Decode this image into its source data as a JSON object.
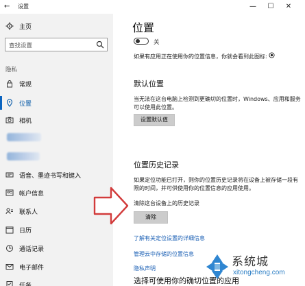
{
  "window": {
    "title": "设置",
    "back_icon": "back-arrow-icon",
    "minimize_glyph": "—",
    "maximize_glyph": "☐",
    "close_glyph": "✕"
  },
  "sidebar": {
    "home_label": "主页",
    "search_placeholder": "查找设置",
    "group_label": "隐私",
    "items": [
      {
        "label": "常规",
        "icon": "lock-icon",
        "active": false
      },
      {
        "label": "位置",
        "icon": "location-icon",
        "active": true
      },
      {
        "label": "相机",
        "icon": "camera-icon",
        "active": false
      },
      {
        "label": "语音、墨迹书写和键入",
        "icon": "ink-icon",
        "active": false
      },
      {
        "label": "帐户信息",
        "icon": "account-icon",
        "active": false
      },
      {
        "label": "联系人",
        "icon": "contacts-icon",
        "active": false
      },
      {
        "label": "日历",
        "icon": "calendar-icon",
        "active": false
      },
      {
        "label": "通话记录",
        "icon": "call-history-icon",
        "active": false
      },
      {
        "label": "电子邮件",
        "icon": "email-icon",
        "active": false
      },
      {
        "label": "任务",
        "icon": "tasks-icon",
        "active": false
      }
    ],
    "accent_color": "#0a64c0"
  },
  "main": {
    "page_title": "位置",
    "toggle_state_label": "关",
    "app_using_text": "如果有应用正在使用你的位置信息，你就会看到此图标:",
    "app_using_icon": "location-indicator-icon",
    "default_location": {
      "title": "默认位置",
      "description": "当无法在这台电脑上检测到更确切的位置时，Windows、应用和服务可以使用此位置。",
      "button_label": "设置默认值"
    },
    "history": {
      "title": "位置历史记录",
      "description": "如果定位功能已打开，则你的位置历史记录将在设备上被存储一段有限的时间，并可供使用你的位置信息的应用使用。",
      "clear_label": "清除这台设备上的历史记录",
      "clear_button": "清除"
    },
    "links": [
      "了解有关定位设置的详细信息",
      "管理云中存储的位置信息",
      "隐私声明"
    ],
    "bottom_title": "选择可使用你的确切位置的应用"
  },
  "watermark": {
    "brand": "系统城",
    "url": "xitongcheng.com"
  }
}
